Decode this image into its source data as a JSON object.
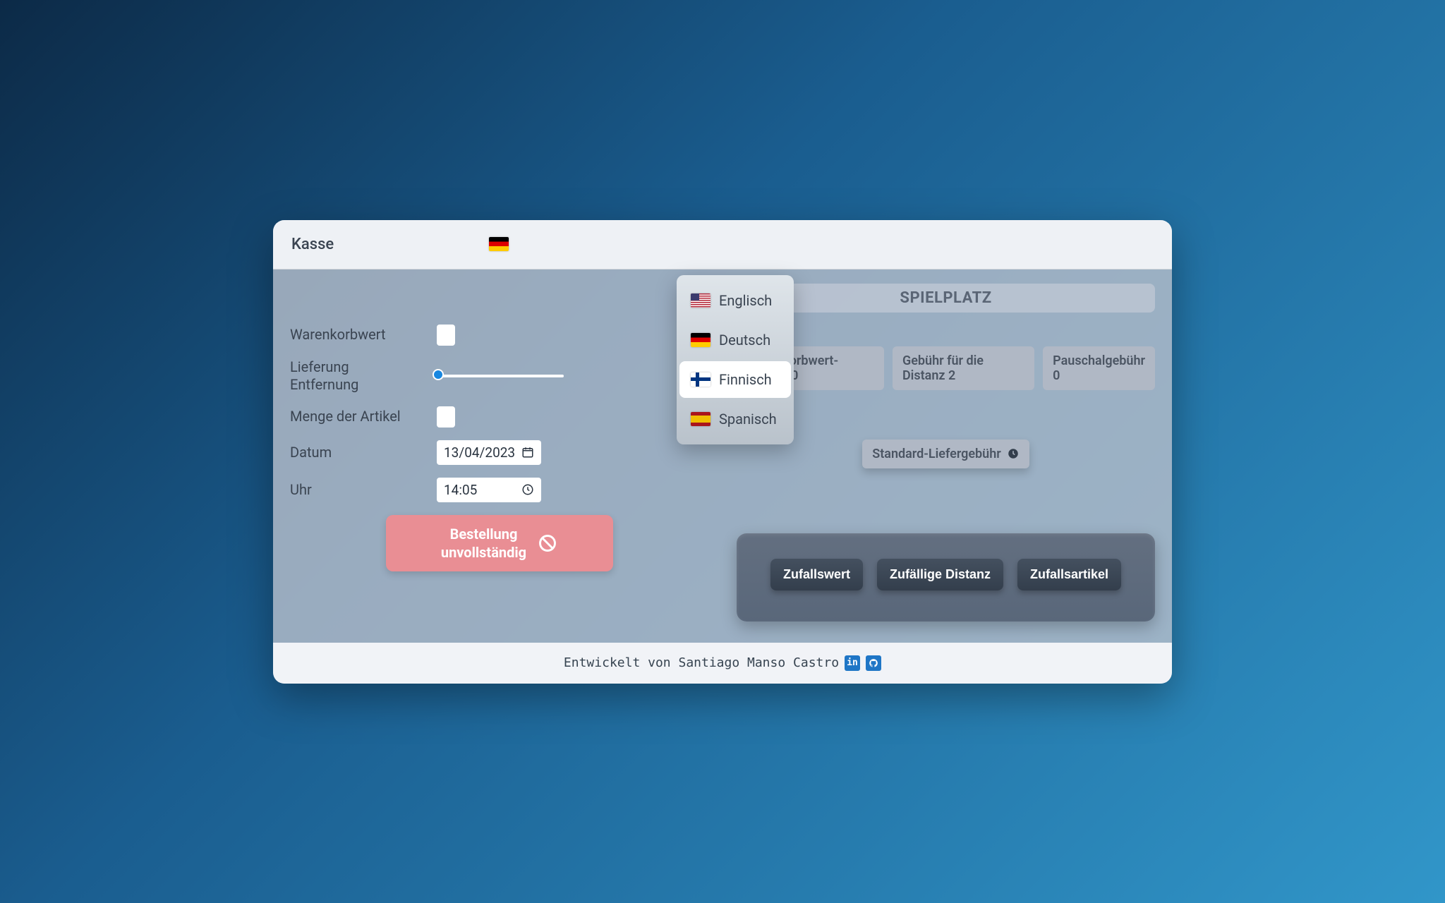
{
  "header": {
    "title": "Kasse"
  },
  "languages": {
    "options": [
      {
        "label": "Englisch"
      },
      {
        "label": "Deutsch"
      },
      {
        "label": "Finnisch"
      },
      {
        "label": "Spanisch"
      }
    ]
  },
  "form": {
    "cart_label": "Warenkorbwert",
    "distance_label_line1": "Lieferung",
    "distance_label_line2": "Entfernung",
    "distance_value": "0m",
    "items_label": "Menge der Artikel",
    "date_label": "Datum",
    "date_value": "13/04/2023",
    "time_label": "Uhr",
    "time_value": "14:05",
    "submit_line1": "Bestellung",
    "submit_line2": "unvollständig"
  },
  "playground": {
    "heading": "SPIELPLATZ",
    "fees": {
      "cart": "Warenkorbwert-Gebühr 0",
      "distance": "Gebühr für die Distanz 2",
      "flat": "Pauschalgebühr 0"
    },
    "standard_fee": "Standard-Liefergebühr",
    "actions": {
      "rand_value": "Zufallswert",
      "rand_distance": "Zufällige Distanz",
      "rand_items": "Zufallsartikel"
    }
  },
  "footer": {
    "text": "Entwickelt von Santiago Manso Castro"
  }
}
